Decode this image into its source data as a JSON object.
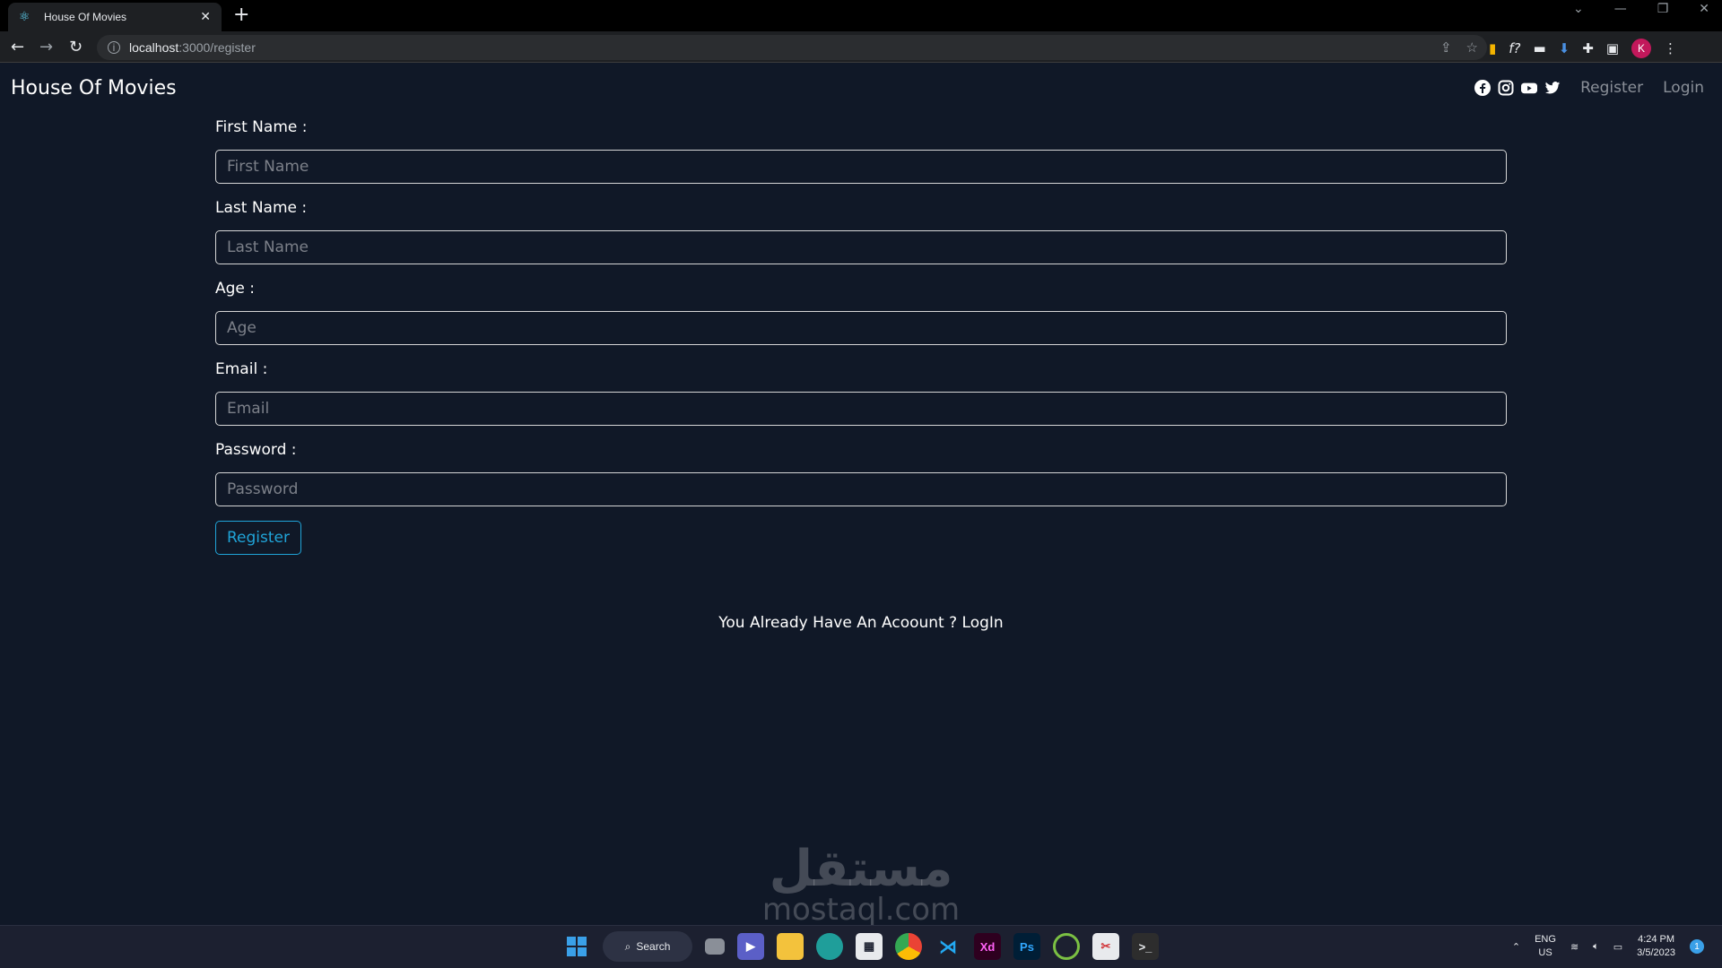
{
  "browser": {
    "tab_title": "House Of Movies",
    "url_host": "localhost",
    "url_path": ":3000/register",
    "profile_initial": "K"
  },
  "navbar": {
    "brand": "House Of Movies",
    "links": {
      "register": "Register",
      "login": "Login"
    },
    "social_icons": [
      "facebook-icon",
      "instagram-icon",
      "youtube-icon",
      "twitter-icon"
    ]
  },
  "form": {
    "first_name": {
      "label": "First Name :",
      "placeholder": "First Name"
    },
    "last_name": {
      "label": "Last Name :",
      "placeholder": "Last Name"
    },
    "age": {
      "label": "Age :",
      "placeholder": "Age"
    },
    "email": {
      "label": "Email :",
      "placeholder": "Email"
    },
    "password": {
      "label": "Password :",
      "placeholder": "Password"
    },
    "submit_label": "Register",
    "already_text": "You Already Have An Acoount ? LogIn"
  },
  "watermark": {
    "arabic": "مستقل",
    "latin": "mostaql.com"
  },
  "taskbar": {
    "search_label": "Search",
    "lang_top": "ENG",
    "lang_bottom": "US",
    "time": "4:24 PM",
    "date": "3/5/2023",
    "notification_count": "1"
  },
  "colors": {
    "background": "#101827",
    "accent": "#20a4d8",
    "nav_link": "#8a8f98"
  }
}
